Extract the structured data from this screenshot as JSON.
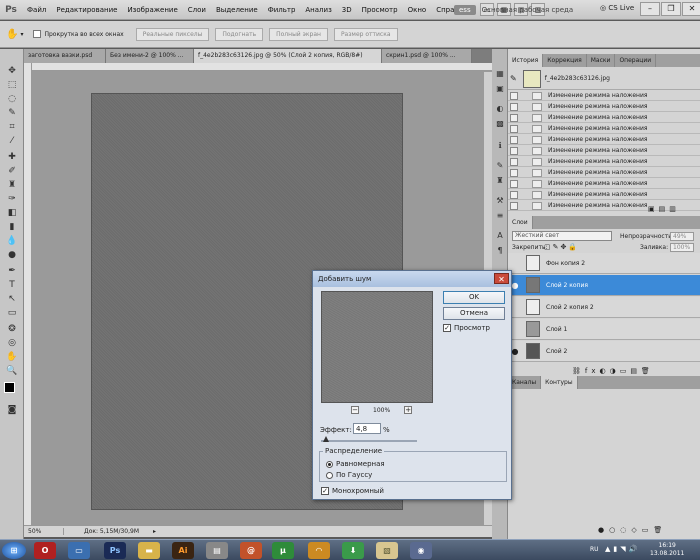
{
  "menu": {
    "app_icon": "Ps",
    "items": [
      "Файл",
      "Редактирование",
      "Изображение",
      "Слои",
      "Выделение",
      "Фильтр",
      "Анализ",
      "3D",
      "Просмотр",
      "Окно",
      "Справка"
    ],
    "workspace": "ess",
    "workspace_other": "Основная рабочая среда",
    "cslive": "CS Live"
  },
  "options": {
    "scroll_all": "Прокрутка во всех окнах",
    "buttons": [
      "Реальные пикселы",
      "Подогнать",
      "Полный экран",
      "Размер оттиска"
    ]
  },
  "tabs": [
    "заготовка вазки.psd",
    "Без имени-2 @ 100% ...",
    "f_4e2b283c63126.jpg @ 50% (Слой 2 копия, RGB/8#)",
    "скрин1.psd @ 100% ..."
  ],
  "status": {
    "zoom": "50%",
    "doc": "Док: 5,15M/30,9M"
  },
  "history": {
    "tabs": [
      "История",
      "Коррекция",
      "Маски",
      "Операции"
    ],
    "snapshot": "f_4e2b283c63126.jpg",
    "items": [
      "Изменение режима наложения",
      "Изменение режима наложения",
      "Изменение режима наложения",
      "Изменение режима наложения",
      "Изменение режима наложения",
      "Изменение режима наложения",
      "Изменение режима наложения",
      "Изменение режима наложения",
      "Изменение режима наложения",
      "Изменение режима наложения",
      "Изменение режима наложения"
    ]
  },
  "layers": {
    "tab": "Слои",
    "blend": "Жесткий свет",
    "opacity_label": "Непрозрачность:",
    "opacity": "49%",
    "lock_label": "Закрепить:",
    "fill_label": "Заливка:",
    "fill": "100%",
    "items": [
      "Фон копия 2",
      "Слой 2 копия",
      "Слой 2 копия 2",
      "Слой 1",
      "Слой 2"
    ],
    "bottom_tabs": [
      "Каналы",
      "Контуры"
    ]
  },
  "dialog": {
    "title": "Добавить шум",
    "ok": "OK",
    "cancel": "Отмена",
    "preview": "Просмотр",
    "zoom": "100%",
    "effect_label": "Эффект:",
    "effect_value": "4,8",
    "effect_unit": "%",
    "effect_slider_fraction": 0.05,
    "distribution_label": "Распределение",
    "uniform": "Равномерная",
    "gaussian": "По Гауссу",
    "mono": "Монохромный"
  },
  "taskbar": {
    "lang": "RU",
    "time": "16:19",
    "date": "13.08.2011",
    "ps": "Ps",
    "ai": "Ai"
  }
}
